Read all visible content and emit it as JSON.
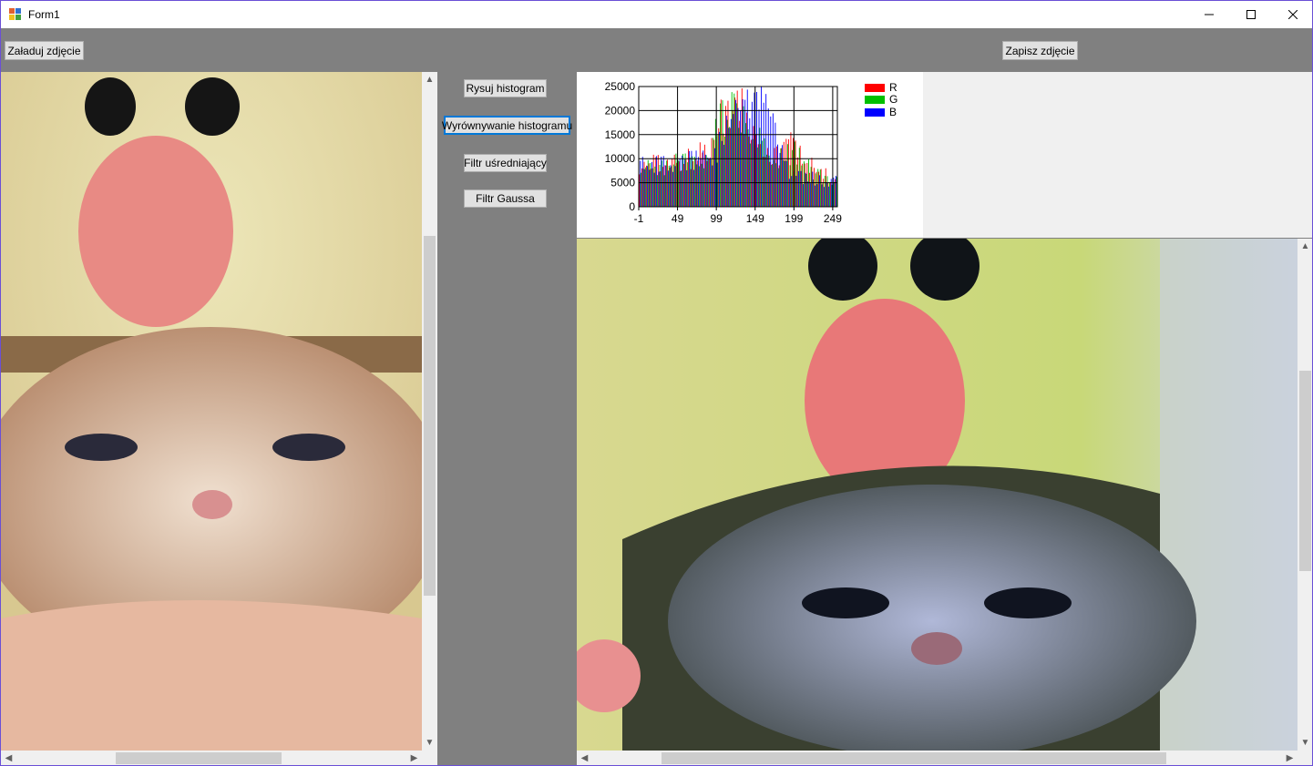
{
  "window": {
    "title": "Form1",
    "minimize_glyph": "—",
    "maximize_glyph": "☐",
    "close_glyph": "✕"
  },
  "toolbar": {
    "load_label": "Załaduj zdjęcie",
    "save_label": "Zapisz zdjęcie"
  },
  "actions": {
    "histogram_label": "Rysuj histogram",
    "equalize_label": "Wyrównywanie histogramu",
    "mean_filter_label": "Filtr uśredniający",
    "gauss_label": "Filtr Gaussa"
  },
  "scroll_glyphs": {
    "up": "▲",
    "down": "▼",
    "left": "◀",
    "right": "▶"
  },
  "colors": {
    "accent": "#0078d7",
    "R": "#ff0000",
    "G": "#00c000",
    "B": "#0000ff"
  },
  "chart_data": {
    "type": "bar",
    "title": "",
    "xlabel": "",
    "ylabel": "",
    "x_ticks": [
      "-1",
      "49",
      "99",
      "149",
      "199",
      "249"
    ],
    "y_ticks": [
      "0",
      "5000",
      "10000",
      "15000",
      "20000",
      "25000"
    ],
    "xlim": [
      -1,
      255
    ],
    "ylim": [
      0,
      25000
    ],
    "legend_position": "right",
    "series": [
      {
        "name": "R",
        "color": "#ff0000",
        "profile_x": [
          0,
          10,
          30,
          50,
          70,
          90,
          100,
          110,
          120,
          130,
          140,
          150,
          160,
          170,
          180,
          190,
          200,
          210,
          220,
          230,
          240,
          255
        ],
        "profile_y": [
          8000,
          8500,
          9000,
          9500,
          10000,
          12000,
          17000,
          20000,
          22000,
          21000,
          19000,
          16000,
          13000,
          11000,
          10000,
          13000,
          14000,
          11000,
          8500,
          7000,
          6500,
          5500
        ]
      },
      {
        "name": "G",
        "color": "#00c000",
        "profile_x": [
          0,
          10,
          30,
          50,
          70,
          90,
          100,
          110,
          120,
          130,
          140,
          150,
          160,
          170,
          180,
          190,
          200,
          210,
          220,
          230,
          240,
          255
        ],
        "profile_y": [
          7500,
          8000,
          8500,
          9000,
          9500,
          11000,
          16000,
          19000,
          21000,
          20000,
          18000,
          15000,
          12000,
          10500,
          9500,
          11000,
          12000,
          9500,
          7500,
          6500,
          6000,
          5000
        ]
      },
      {
        "name": "B",
        "color": "#0000ff",
        "profile_x": [
          0,
          10,
          30,
          50,
          70,
          90,
          100,
          110,
          120,
          130,
          140,
          150,
          160,
          170,
          180,
          190,
          200,
          210,
          220,
          230,
          240,
          255
        ],
        "profile_y": [
          10000,
          9500,
          9000,
          9500,
          10000,
          10500,
          12000,
          15000,
          18000,
          19000,
          20000,
          21000,
          23000,
          22000,
          15000,
          8000,
          6500,
          6000,
          6000,
          5500,
          5000,
          5500
        ]
      }
    ]
  }
}
